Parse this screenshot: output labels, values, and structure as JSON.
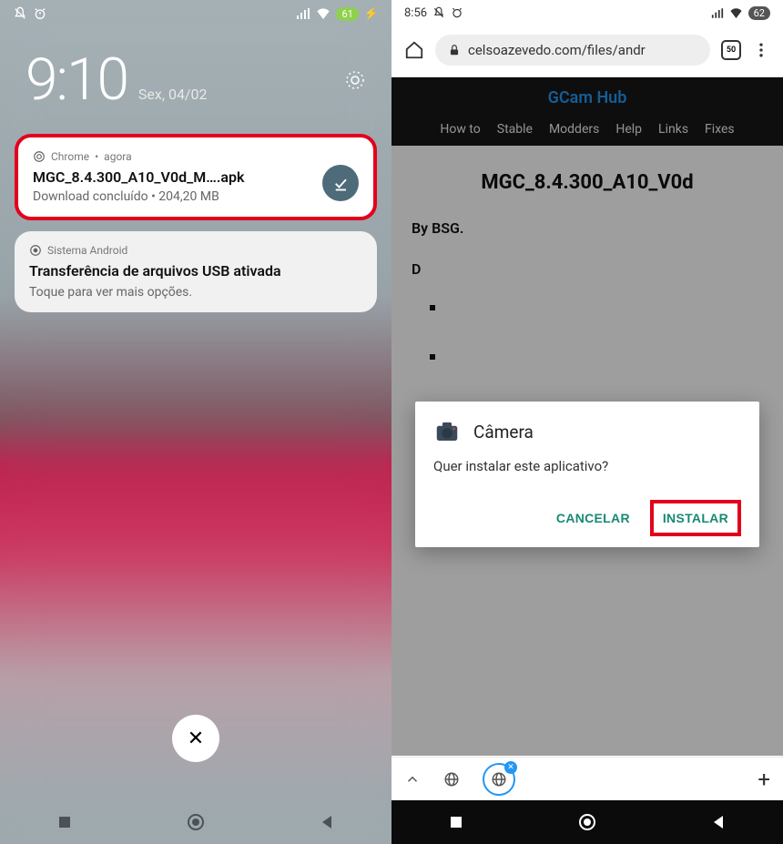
{
  "left": {
    "status": {
      "battery": "61",
      "charging": "⚡"
    },
    "lock": {
      "time": "9:10",
      "date": "Sex, 04/02"
    },
    "notif1": {
      "app": "Chrome",
      "time_sep": " • ",
      "time_label": "agora",
      "title": "MGC_8.4.300_A10_V0d_M….apk",
      "subtitle": "Download concluído • 204,20 MB"
    },
    "notif2": {
      "app": "Sistema Android",
      "title": "Transferência de arquivos USB ativada",
      "subtitle": "Toque para ver mais opções."
    },
    "dismiss": "✕"
  },
  "right": {
    "status": {
      "time": "8:56",
      "battery": "62"
    },
    "browser": {
      "url": "celsoazevedo.com/files/andr",
      "tabcount": "50"
    },
    "site": {
      "title": "GCam Hub",
      "nav": [
        "How to",
        "Stable",
        "Modders",
        "Help",
        "Links",
        "Fixes"
      ]
    },
    "page": {
      "title": "MGC_8.4.300_A10_V0d",
      "byline": "By BSG.",
      "download_prefix": "D"
    },
    "dialog": {
      "app_name": "Câmera",
      "message": "Quer instalar este aplicativo?",
      "cancel": "CANCELAR",
      "install": "INSTALAR"
    }
  }
}
